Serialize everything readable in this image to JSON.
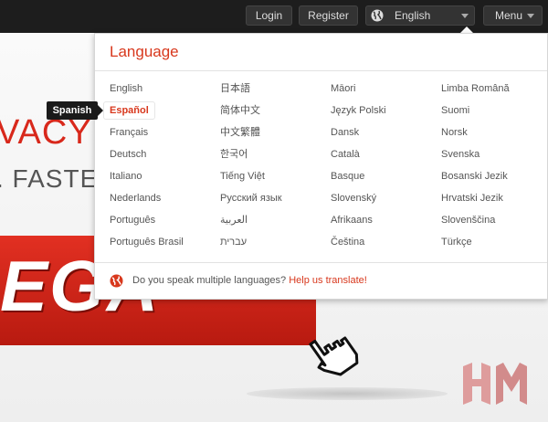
{
  "topbar": {
    "login_label": "Login",
    "register_label": "Register",
    "language_label": "English",
    "menu_label": "Menu"
  },
  "hero": {
    "title": "VACY C",
    "subtitle": ". FASTER. S",
    "banner_text": "EGA"
  },
  "language_panel": {
    "title": "Language",
    "columns": [
      [
        "English",
        "Español",
        "Français",
        "Deutsch",
        "Italiano",
        "Nederlands",
        "Português",
        "Português Brasil"
      ],
      [
        "日本語",
        "简体中文",
        "中文繁體",
        "한국어",
        "Tiếng Việt",
        "Русский язык",
        "العربية",
        "עברית"
      ],
      [
        "Māori",
        "Język Polski",
        "Dansk",
        "Català",
        "Basque",
        "Slovenský",
        "Afrikaans",
        "Čeština"
      ],
      [
        "Limba Română",
        "Suomi",
        "Norsk",
        "Svenska",
        "Bosanski Jezik",
        "Hrvatski Jezik",
        "Slovenščina",
        "Türkçe"
      ]
    ],
    "active_language": "Español",
    "footer_text": "Do you speak multiple languages? ",
    "footer_link": "Help us translate!"
  },
  "tooltip": {
    "text": "Spanish"
  },
  "colors": {
    "accent": "#d8381d",
    "topbar": "#1d1d1d",
    "banner": "#d8281b"
  }
}
